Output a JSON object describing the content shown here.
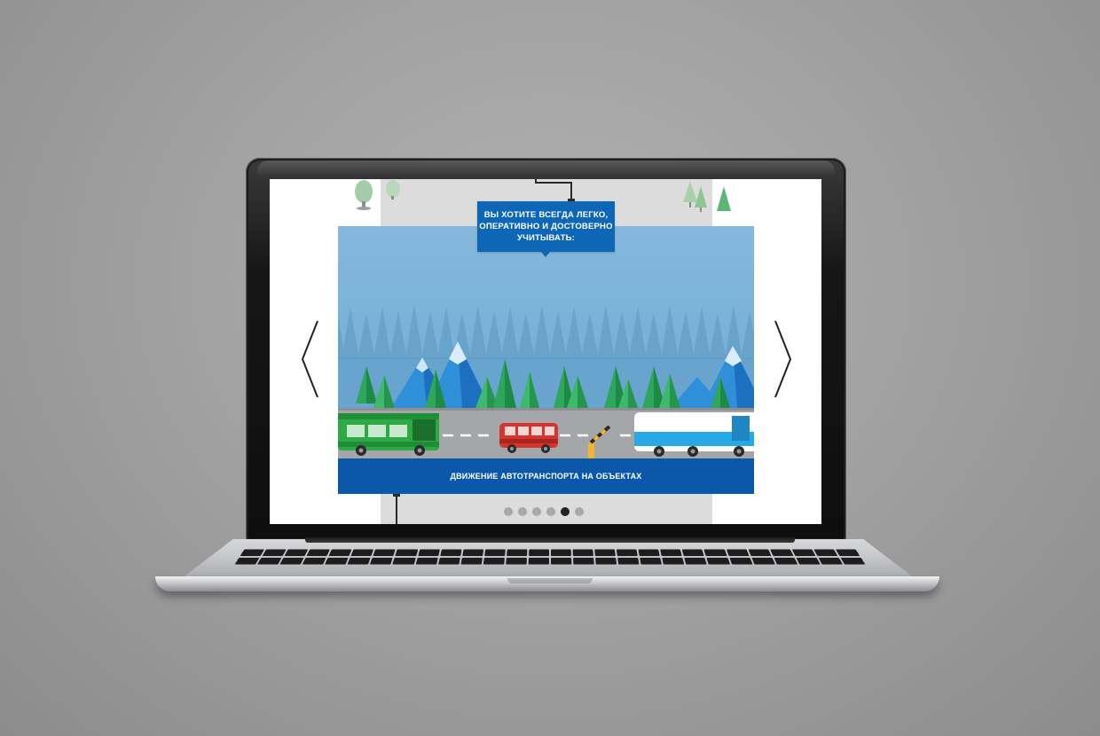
{
  "slide": {
    "question_lines": [
      "Вы хотите всегда легко,",
      "оперативно и достоверно",
      "учитывать:"
    ],
    "caption": "Движение автотранспорта на объектах",
    "total_slides": 6,
    "active_slide": 5
  },
  "colors": {
    "accent_blue": "#0d67b6",
    "caption_bar": "#0b58aa",
    "sky": "#78b2d8",
    "tree_green": "#2ea65b",
    "bus_green": "#2eaa45",
    "bus_blue": "#27a9e6",
    "car_red": "#d6352f"
  },
  "icons": {
    "prev": "chevron-left-icon",
    "next": "chevron-right-icon"
  }
}
